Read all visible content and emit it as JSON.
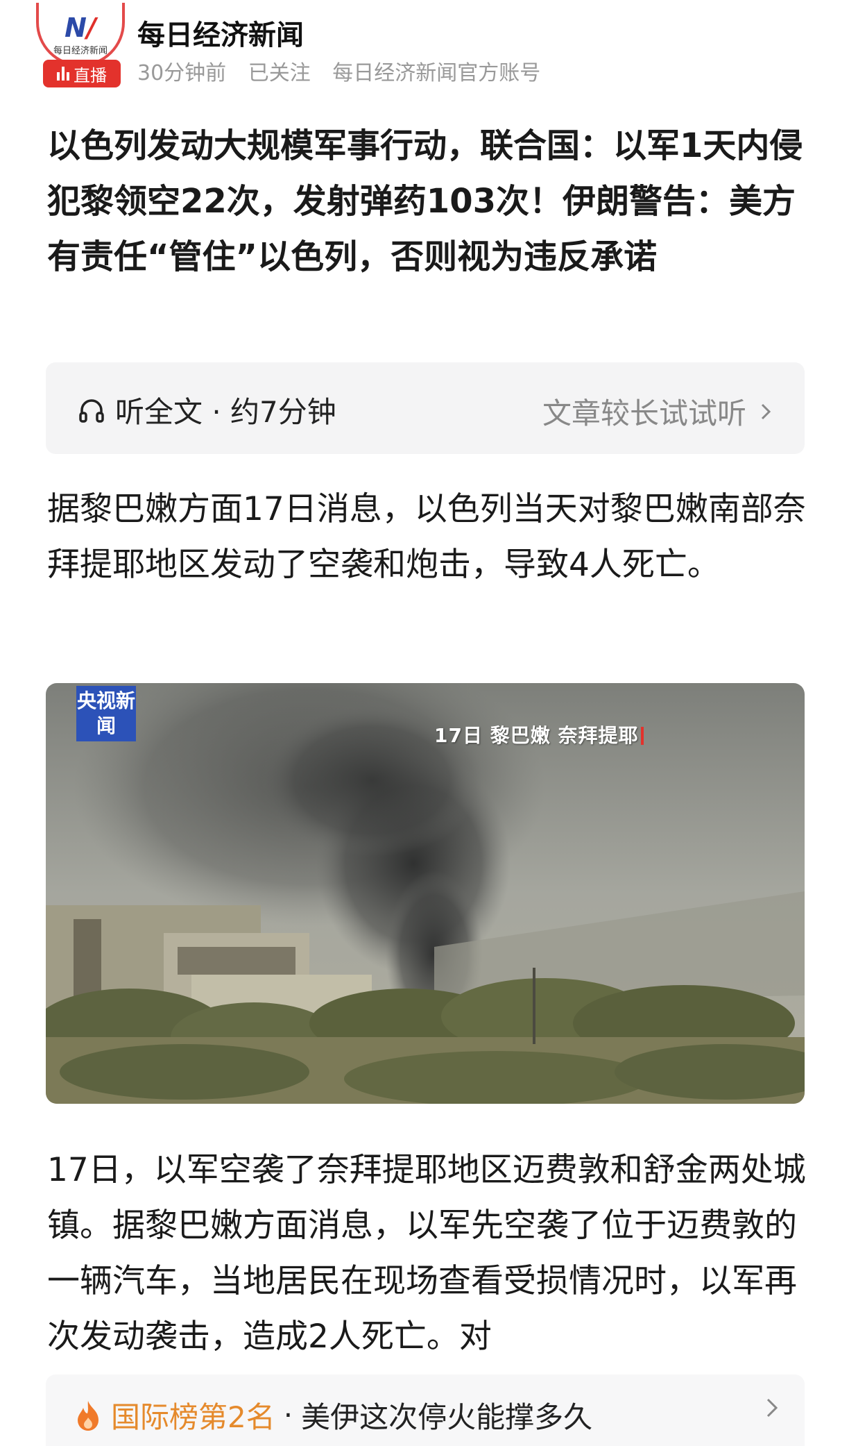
{
  "header": {
    "avatar_text": "每日经济新闻",
    "live_label": "直播",
    "account_name": "每日经济新闻",
    "time": "30分钟前",
    "follow_status": "已关注",
    "account_desc": "每日经济新闻官方账号"
  },
  "article": {
    "title": "以色列发动大规模军事行动，联合国：以军1天内侵犯黎领空22次，发射弹药103次！伊朗警告：美方有责任“管住”以色列，否则视为违反承诺",
    "listen_label": "听全文 · 约7分钟",
    "listen_hint": "文章较长试试听",
    "paragraph1": "据黎巴嫩方面17日消息，以色列当天对黎巴嫩南部奈拜提耶地区发动了空袭和炮击，导致4人死亡。",
    "image": {
      "logo_text": "央视新闻",
      "caption": "17日 黎巴嫩 奈拜提耶"
    },
    "paragraph2": "17日，以军空袭了奈拜提耶地区迈费敦和舒金两处城镇。据黎巴嫩方面消息，以军先空袭了位于迈费敦的一辆汽车，当地居民在现场查看受损情况时，以军再次发动袭击，造成2人死亡。对"
  },
  "hot_list": {
    "rank": "国际榜第2名",
    "separator": "·",
    "topic": "美伊这次停火能撑多久"
  },
  "colors": {
    "live_red": "#e3322c",
    "hot_orange": "#e58a2c",
    "cctv_blue": "#2c52b8"
  }
}
